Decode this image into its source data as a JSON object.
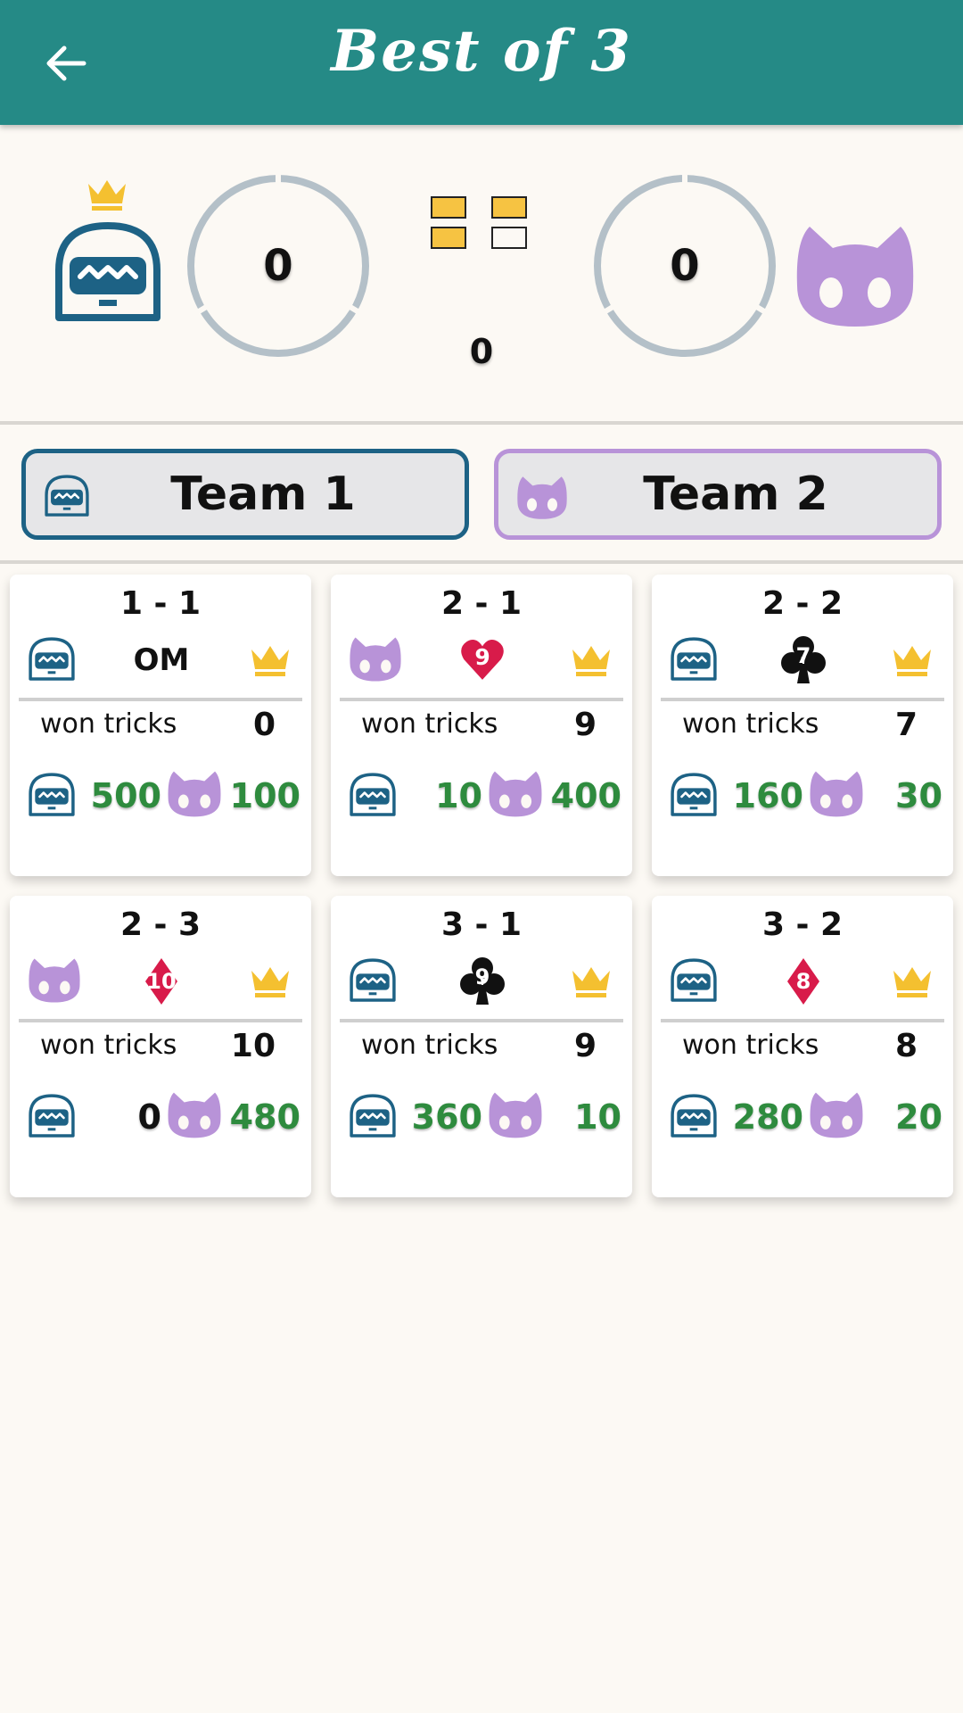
{
  "appbar": {
    "title": "Best of 3"
  },
  "scoreboard": {
    "team1_score": "0",
    "team2_score": "0",
    "center_count": "0",
    "match_progress": [
      true,
      true,
      true,
      false
    ]
  },
  "teams": [
    {
      "label": "Team 1"
    },
    {
      "label": "Team 2"
    }
  ],
  "rounds": [
    {
      "title": "1 - 1",
      "bidder": "team1",
      "contract_text": "OM",
      "contract_suit": "none",
      "contract_value": "",
      "tricks_label": "won tricks",
      "tricks": "0",
      "team1_points": "500",
      "team2_points": "100"
    },
    {
      "title": "2 - 1",
      "bidder": "team2",
      "contract_text": "",
      "contract_suit": "heart",
      "contract_value": "9",
      "tricks_label": "won tricks",
      "tricks": "9",
      "team1_points": "10",
      "team2_points": "400"
    },
    {
      "title": "2 - 2",
      "bidder": "team1",
      "contract_text": "",
      "contract_suit": "club",
      "contract_value": "7",
      "tricks_label": "won tricks",
      "tricks": "7",
      "team1_points": "160",
      "team2_points": "30"
    },
    {
      "title": "2 - 3",
      "bidder": "team2",
      "contract_text": "",
      "contract_suit": "diamond",
      "contract_value": "10",
      "tricks_label": "won tricks",
      "tricks": "10",
      "team1_points": "0",
      "team2_points": "480"
    },
    {
      "title": "3 - 1",
      "bidder": "team1",
      "contract_text": "",
      "contract_suit": "club",
      "contract_value": "9",
      "tricks_label": "won tricks",
      "tricks": "9",
      "team1_points": "360",
      "team2_points": "10"
    },
    {
      "title": "3 - 2",
      "bidder": "team1",
      "contract_text": "",
      "contract_suit": "diamond",
      "contract_value": "8",
      "tricks_label": "won tricks",
      "tricks": "8",
      "team1_points": "280",
      "team2_points": "20"
    }
  ],
  "colors": {
    "appbar": "#258a86",
    "team1": "#1d6285",
    "team2": "#b893d8",
    "crown": "#f4c030",
    "points": "#2e8b3e",
    "red_suit": "#d81b4a",
    "ring": "#b4c0c8"
  }
}
